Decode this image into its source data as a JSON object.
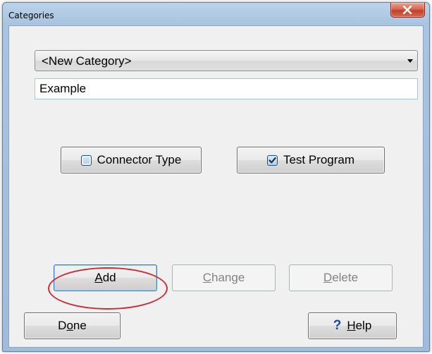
{
  "window": {
    "title": "Categories"
  },
  "category_select": {
    "selected": "<New Category>"
  },
  "name_field": {
    "value": "Example"
  },
  "toggles": {
    "connector_type": {
      "label": "Connector Type",
      "checked": false
    },
    "test_program": {
      "label": "Test Program",
      "checked": true
    }
  },
  "actions": {
    "add_prefix": "",
    "add_mnemonic": "A",
    "add_rest": "dd",
    "change_mnemonic": "C",
    "change_rest": "hange",
    "delete_mnemonic": "D",
    "delete_rest": "elete"
  },
  "footer": {
    "done_prefix": "D",
    "done_mnemonic": "o",
    "done_rest": "ne",
    "help_glyph": "?",
    "help_mnemonic": "H",
    "help_rest": "elp"
  },
  "colors": {
    "annotation": "#c5303a",
    "checkbox_blue": "#1d5180",
    "help_icon": "#1a49a8"
  },
  "icons": {
    "close": "close-icon",
    "dropdown": "chevron-down-icon",
    "help": "question-icon"
  }
}
